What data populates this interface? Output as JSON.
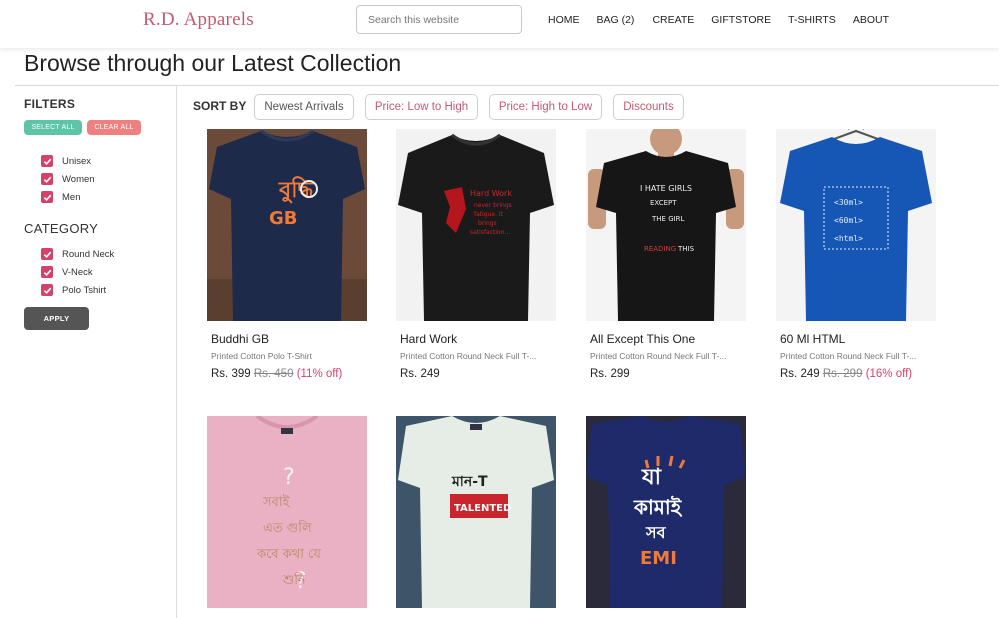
{
  "header": {
    "brand": "R.D. Apparels",
    "search_placeholder": "Search this website",
    "nav": [
      "HOME",
      "BAG (2)",
      "CREATE",
      "GIFTSTORE",
      "T-SHIRTS",
      "ABOUT"
    ]
  },
  "page_title": "Browse through our Latest Collection",
  "filters": {
    "title": "FILTERS",
    "select_all": "SELECT ALL",
    "clear_all": "CLEAR ALL",
    "gender": [
      "Unisex",
      "Women",
      "Men"
    ],
    "category_title": "CATEGORY",
    "categories": [
      "Round Neck",
      "V-Neck",
      "Polo Tshirt"
    ],
    "apply": "APPLY"
  },
  "sort": {
    "label": "SORT BY",
    "options": [
      "Newest Arrivals",
      "Price: Low to High",
      "Price: High to Low",
      "Discounts"
    ]
  },
  "products": [
    {
      "name": "Buddhi GB",
      "desc": "Printed Cotton Polo T-Shirt",
      "price": "Rs. 399",
      "mrp": "Rs. 450",
      "off": "(11% off)",
      "shirt_color": "#1d2a4a",
      "print_text": "GB"
    },
    {
      "name": "Hard Work",
      "desc": "Printed Cotton Round Neck Full T-...",
      "price": "Rs. 249",
      "mrp": "",
      "off": "",
      "shirt_color": "#1a1a1a",
      "print_text": "Hard Work"
    },
    {
      "name": "All Except This One",
      "desc": "Printed Cotton Round Neck Full T-...",
      "price": "Rs. 299",
      "mrp": "",
      "off": "",
      "shirt_color": "#161616",
      "print_text": "I HATE GIRLS"
    },
    {
      "name": "60 Ml HTML",
      "desc": "Printed Cotton Round Neck Full T-...",
      "price": "Rs. 249",
      "mrp": "Rs. 299",
      "off": "(16% off)",
      "shirt_color": "#1656b5",
      "print_text": "<html>"
    },
    {
      "shirt_color": "#eab0c4",
      "print_text": "?"
    },
    {
      "shirt_color": "#e6ede6",
      "print_text": "TALENTED"
    },
    {
      "shirt_color": "#1e2a6a",
      "print_text": "EMI"
    }
  ]
}
